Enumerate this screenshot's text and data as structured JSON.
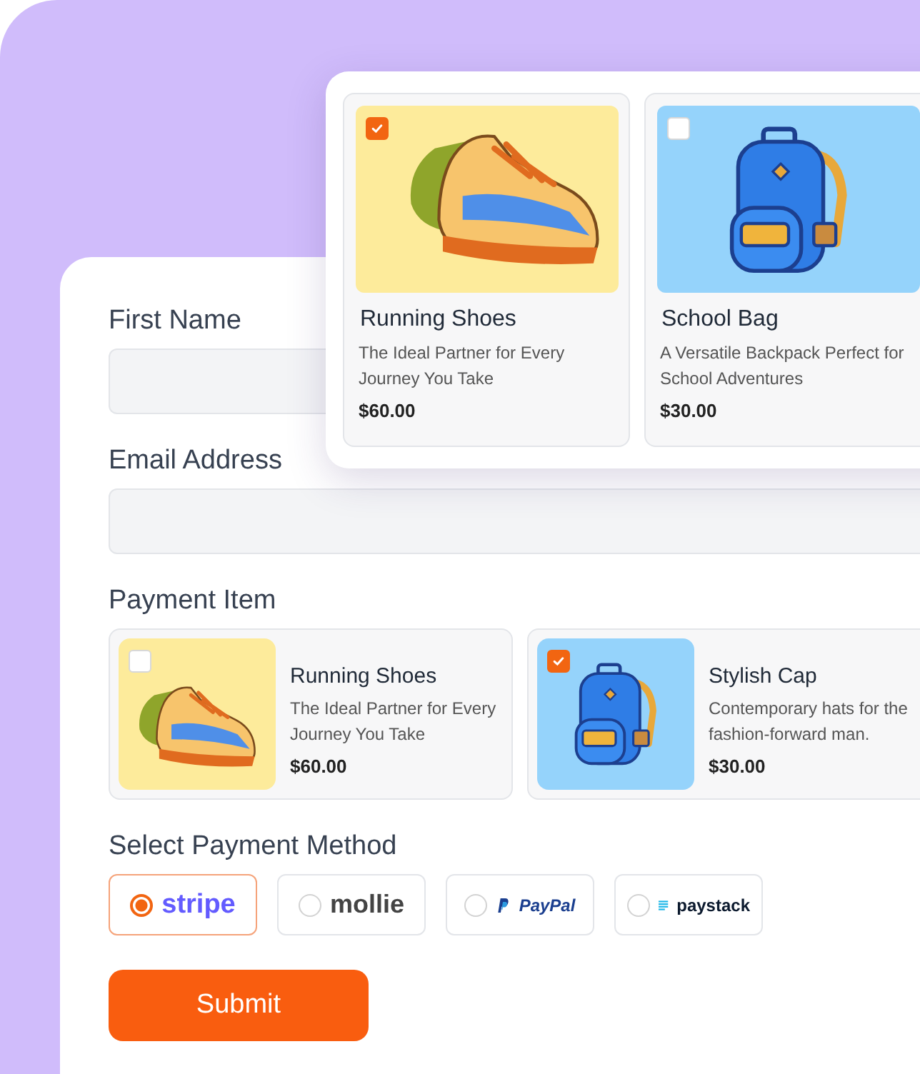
{
  "featured_products": [
    {
      "name": "Running Shoes",
      "description": "The Ideal Partner for Every Journey You Take",
      "price": "$60.00",
      "selected": true,
      "kind": "shoes"
    },
    {
      "name": "School Bag",
      "description": "A Versatile Backpack Perfect for School Adventures",
      "price": "$30.00",
      "selected": false,
      "kind": "backpack"
    }
  ],
  "form": {
    "fields": [
      {
        "label": "First Name"
      },
      {
        "label": "Email Address"
      }
    ],
    "payment_item": {
      "label": "Payment Item",
      "items": [
        {
          "name": "Running Shoes",
          "description": "The Ideal Partner for Every Journey You Take",
          "price": "$60.00",
          "selected": false,
          "kind": "shoes"
        },
        {
          "name": "Stylish Cap",
          "description": "Contemporary hats for the fashion-forward man.",
          "price": "$30.00",
          "selected": true,
          "kind": "backpack"
        }
      ]
    },
    "payment_method": {
      "label": "Select Payment Method",
      "options": [
        {
          "label": "stripe",
          "kind": "stripe",
          "selected": true
        },
        {
          "label": "mollie",
          "kind": "mollie",
          "selected": false
        },
        {
          "label": "PayPal",
          "kind": "paypal",
          "selected": false
        },
        {
          "label": "paystack",
          "kind": "paystack",
          "selected": false
        }
      ]
    },
    "submit": "Submit"
  }
}
